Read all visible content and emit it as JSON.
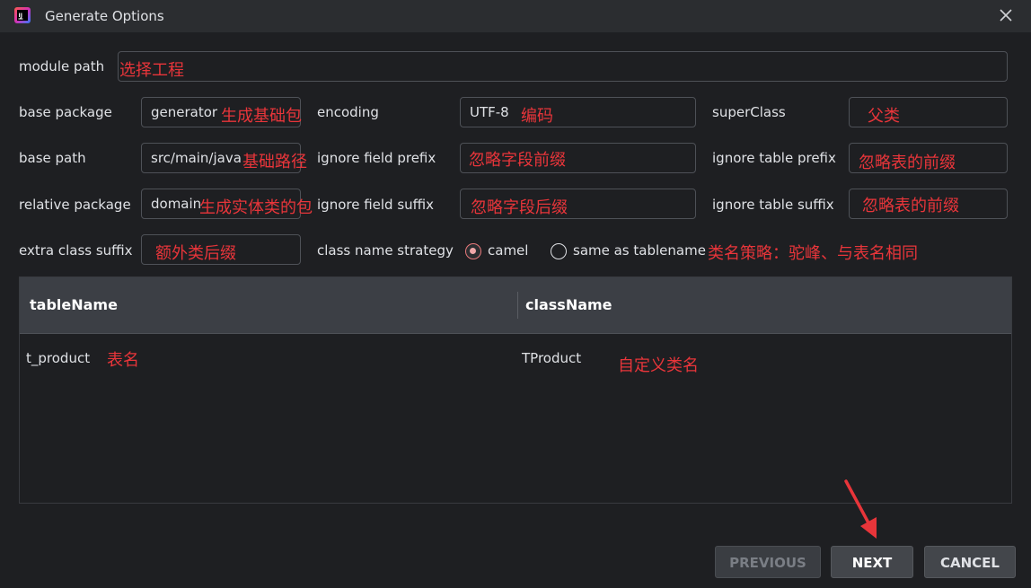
{
  "window": {
    "title": "Generate Options"
  },
  "form": {
    "module_path": {
      "label": "module path",
      "annotation": "选择工程"
    },
    "base_package": {
      "label": "base package",
      "value": "generator",
      "annotation": "生成基础包"
    },
    "encoding": {
      "label": "encoding",
      "value": "UTF-8",
      "annotation": "编码"
    },
    "super_class": {
      "label": "superClass",
      "value": "",
      "annotation": "父类"
    },
    "base_path": {
      "label": "base path",
      "value": "src/main/java",
      "annotation": "基础路径"
    },
    "ignore_field_prefix": {
      "label": "ignore field prefix",
      "value": "",
      "annotation": "忽略字段前缀"
    },
    "ignore_table_prefix": {
      "label": "ignore table prefix",
      "value": "",
      "annotation": "忽略表的前缀"
    },
    "relative_package": {
      "label": "relative package",
      "value": "domain",
      "annotation": "生成实体类的包"
    },
    "ignore_field_suffix": {
      "label": "ignore field suffix",
      "value": "",
      "annotation": "忽略字段后缀"
    },
    "ignore_table_suffix": {
      "label": "ignore table suffix",
      "value": "",
      "annotation": "忽略表的前缀"
    },
    "extra_class_suffix": {
      "label": "extra class suffix",
      "value": "",
      "annotation": "额外类后缀"
    },
    "class_name_strategy": {
      "label": "class name strategy",
      "options": [
        {
          "label": "camel",
          "checked": true
        },
        {
          "label": "same as tablename",
          "checked": false
        }
      ],
      "annotation": "类名策略：驼峰、与表名相同"
    }
  },
  "table": {
    "columns": [
      "tableName",
      "className"
    ],
    "rows": [
      {
        "tableName": "t_product",
        "className": "TProduct",
        "table_annotation": "表名",
        "class_annotation": "自定义类名"
      }
    ]
  },
  "buttons": {
    "previous": "PREVIOUS",
    "next": "NEXT",
    "cancel": "CANCEL"
  },
  "colors": {
    "background": "#1e1f22",
    "annotation": "#e8353a",
    "radio_checked": "#f0a7a8"
  }
}
